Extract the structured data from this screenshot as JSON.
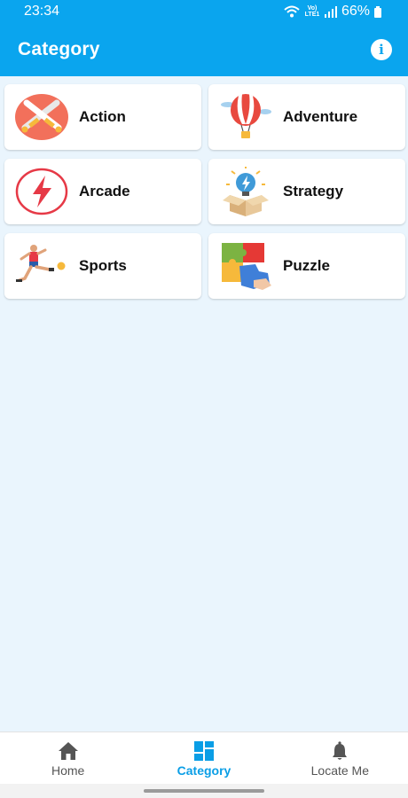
{
  "status_bar": {
    "time": "23:34",
    "network": "Vo) LTE1",
    "battery": "66%"
  },
  "app_bar": {
    "title": "Category",
    "info_icon": "info-icon",
    "info_glyph": "i"
  },
  "categories": [
    {
      "label": "Action",
      "icon": "crossed-swords-icon"
    },
    {
      "label": "Adventure",
      "icon": "hot-air-balloon-icon"
    },
    {
      "label": "Arcade",
      "icon": "lightning-icon"
    },
    {
      "label": "Strategy",
      "icon": "lightbulb-box-icon"
    },
    {
      "label": "Sports",
      "icon": "soccer-player-icon"
    },
    {
      "label": "Puzzle",
      "icon": "puzzle-icon"
    }
  ],
  "bottom_nav": {
    "active": "Category",
    "items": [
      {
        "label": "Home",
        "icon": "home-icon"
      },
      {
        "label": "Category",
        "icon": "dashboard-icon"
      },
      {
        "label": "Locate Me",
        "icon": "bell-icon"
      }
    ]
  },
  "colors": {
    "primary": "#0aa5ee",
    "background": "#eaf5fd",
    "active_nav": "#0a9ee6"
  }
}
